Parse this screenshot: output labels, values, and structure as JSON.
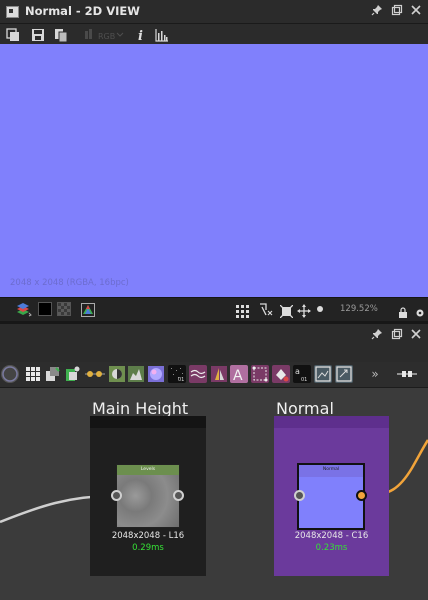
{
  "window": {
    "title": "Normal - 2D VIEW"
  },
  "toolbar": {
    "channel_label": "RGB"
  },
  "view2d": {
    "image_info": "2048 x 2048 (RGBA, 16bpc)",
    "background_color": "#8080fc"
  },
  "statusbar": {
    "zoom": "129.52%"
  },
  "graph": {
    "frames": [
      {
        "title": "Main Height",
        "frame_color": "#1f1f1f",
        "node": {
          "label": "Levels",
          "resolution": "2048x2048 - L16",
          "time": "0.29ms"
        }
      },
      {
        "title": "Normal",
        "frame_color": "#6b3a9c",
        "node": {
          "label": "Normal",
          "resolution": "2048x2048 - C16",
          "time": "0.23ms"
        }
      }
    ],
    "connection_colors": {
      "grayscale": "#d0d0d0",
      "color": "#f2a43a"
    }
  },
  "icons": {
    "title": [
      "app-icon",
      "pin-icon",
      "restore-icon",
      "close-icon"
    ],
    "toolbar": [
      "save-as-icon",
      "save-icon",
      "copy-icon",
      "channel-icon",
      "info-icon",
      "histogram-icon"
    ],
    "statusbar": [
      "layers-icon",
      "black-square-icon",
      "checker-icon",
      "color-icon",
      "grid-icon",
      "tiling-icon",
      "fit-icon",
      "pan-icon",
      "dot-icon",
      "lock-icon",
      "settings-icon"
    ],
    "graph_panel": [
      "pin-icon",
      "restore-icon",
      "close-icon"
    ],
    "node_library": [
      "atomic-icon",
      "grid-icon",
      "blend-icon",
      "gradient-icon",
      "curve-icon",
      "levels-icon",
      "histogram-icon",
      "normal-icon",
      "noise-icon",
      "warp-icon",
      "channels-icon",
      "text-icon",
      "transform-icon",
      "fill-icon",
      "value-icon",
      "image-icon",
      "svg-icon",
      "more-icon",
      "pixel-processor-icon"
    ]
  }
}
